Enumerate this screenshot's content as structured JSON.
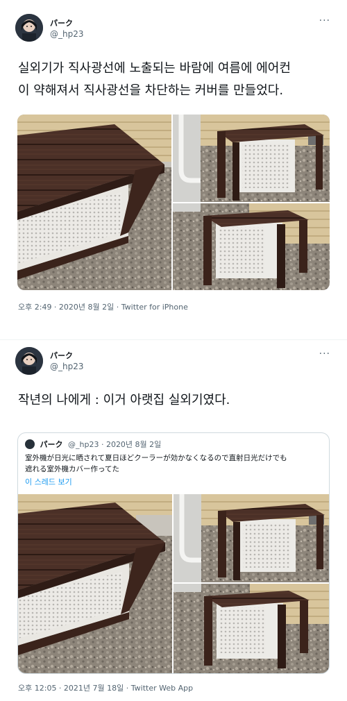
{
  "tweet1": {
    "user": {
      "name": "パーク",
      "handle": "@_hp23"
    },
    "more_label": "···",
    "text_line1": "실외기가 직사광선에 노출되는 바람에 여름에 에어컨",
    "text_line2": "이 약해져서 직사광선을 차단하는 커버를 만들었다.",
    "meta": "오후 2:49 · 2020년 8월 2일 · Twitter for iPhone",
    "photos": [
      "outdoor-unit-cover-photo",
      "outdoor-unit-cover-photo",
      "outdoor-unit-cover-photo"
    ]
  },
  "tweet2": {
    "user": {
      "name": "パーク",
      "handle": "@_hp23"
    },
    "more_label": "···",
    "text": "작년의 나에게 : 이거 아랫집 실외기였다.",
    "quote": {
      "name": "パーク",
      "handle_date": "@_hp23 · 2020년 8월 2일",
      "text_line1": "室外機が日光に晒されて夏日ほどクーラーが効かなくなるので直射日光だけでも",
      "text_line2": "遮れる室外機カバー作ってた",
      "thread_link": "이 스레드 보기"
    },
    "meta": "오후 12:05 · 2021년 7월 18일 · Twitter Web App"
  },
  "colors": {
    "wood": "#4a2f25",
    "siding": "#d9c49a",
    "gravel": "#8b847a",
    "link": "#1d9bf0",
    "secondary_text": "#536471"
  }
}
